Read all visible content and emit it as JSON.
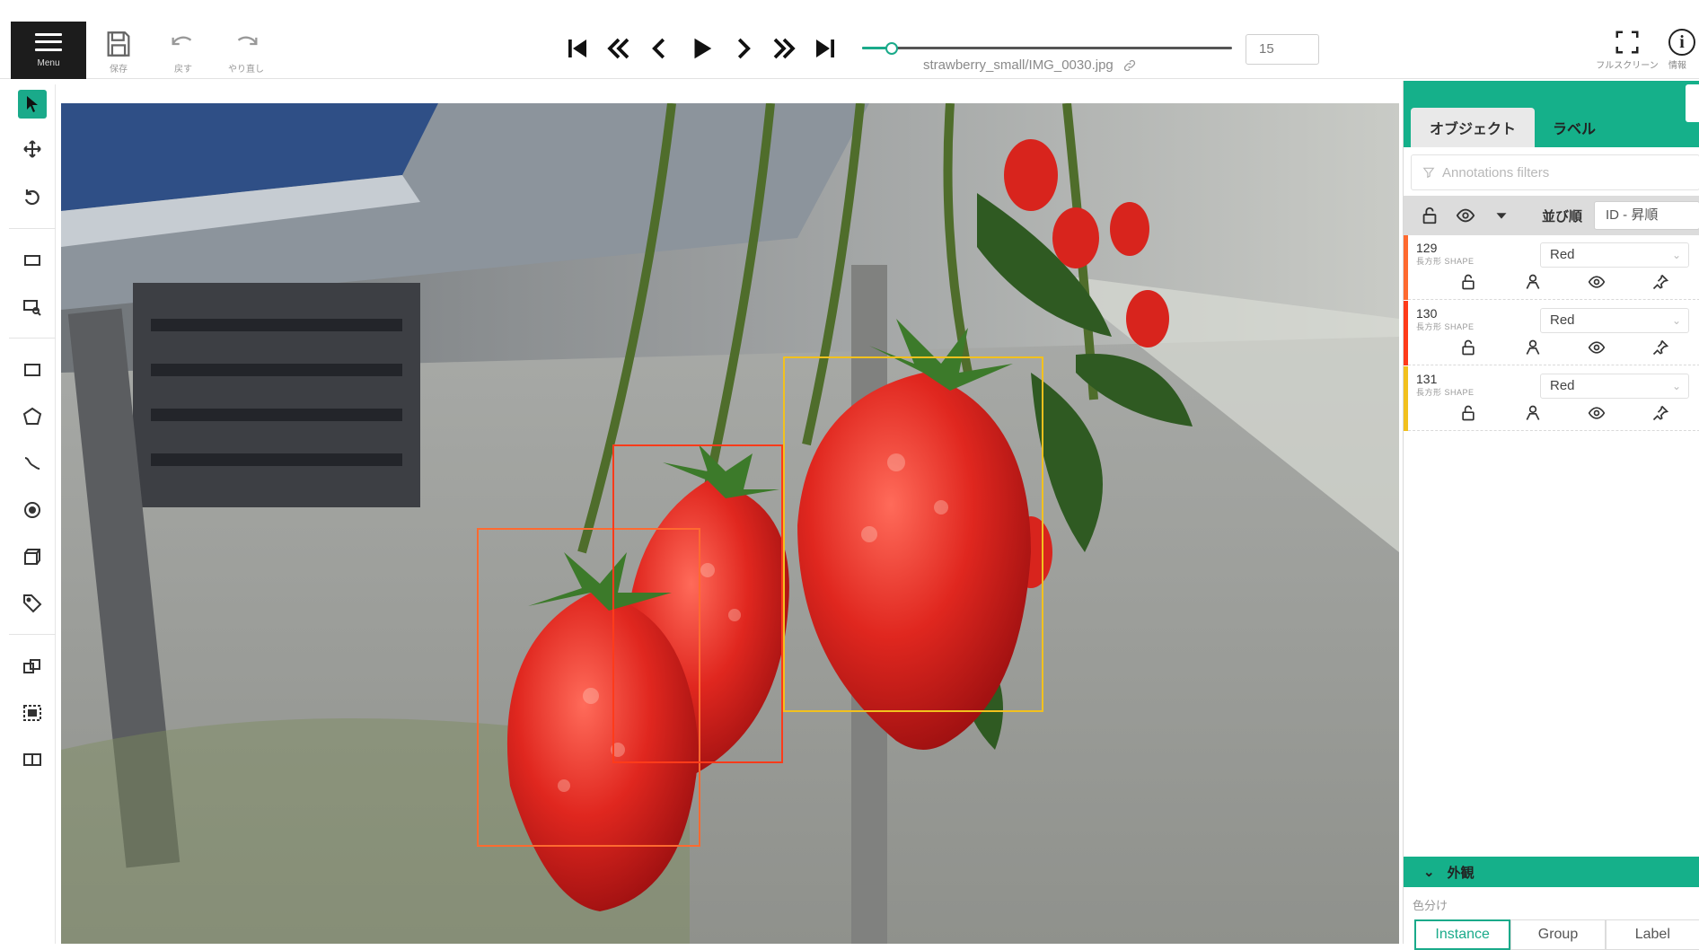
{
  "toolbar": {
    "menu_label": "Menu",
    "save_label": "保存",
    "undo_label": "戻す",
    "redo_label": "やり直し",
    "fullscreen_label": "フルスクリーン",
    "info_label": "情報"
  },
  "player": {
    "filename": "strawberry_small/IMG_0030.jpg",
    "frame_number": "15",
    "progress": 0.08
  },
  "right_panel": {
    "tabs": [
      "オブジェクト",
      "ラベル"
    ],
    "active_tab": "オブジェクト",
    "filter_placeholder": "Annotations filters",
    "sort_label": "並び順",
    "sort_value": "ID - 昇順",
    "objects": [
      {
        "id": "129",
        "type": "長方形 SHAPE",
        "label": "Red",
        "color": "#ff6a30"
      },
      {
        "id": "130",
        "type": "長方形 SHAPE",
        "label": "Red",
        "color": "#ff3b1a"
      },
      {
        "id": "131",
        "type": "長方形 SHAPE",
        "label": "Red",
        "color": "#f2c11e"
      }
    ],
    "appearance_label": "外観",
    "color_by_label": "色分け",
    "color_by_options": [
      "Instance",
      "Group",
      "Label"
    ],
    "color_by_selected": "Instance"
  },
  "colors": {
    "accent": "#1aaa8a",
    "panel_header": "#15b08a"
  }
}
